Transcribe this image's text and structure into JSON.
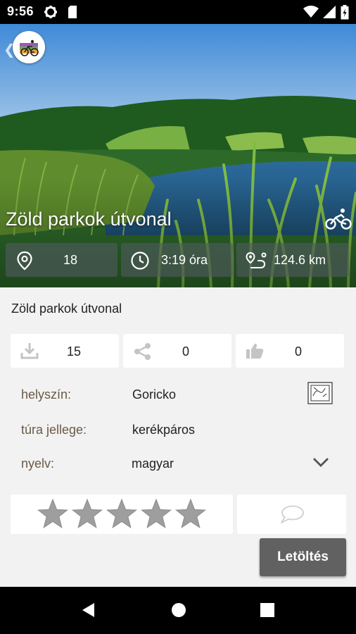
{
  "status_bar": {
    "time": "9:56"
  },
  "hero": {
    "title": "Zöld parkok útvonal",
    "stats": {
      "points": "18",
      "duration": "3:19 óra",
      "distance": "124.6 km"
    }
  },
  "details": {
    "subtitle": "Zöld parkok útvonal",
    "downloads": "15",
    "shares": "0",
    "likes": "0",
    "info": [
      {
        "label": "helyszín:",
        "value": "Goricko"
      },
      {
        "label": "túra jellege:",
        "value": "kerékpáros"
      },
      {
        "label": "nyelv:",
        "value": "magyar"
      }
    ],
    "rating_stars": 5,
    "rating_value": 0
  },
  "download_button": "Letöltés",
  "colors": {
    "accent_gray": "#616161",
    "label_brown": "#6a5a45",
    "star_gray": "#9e9e9e"
  }
}
